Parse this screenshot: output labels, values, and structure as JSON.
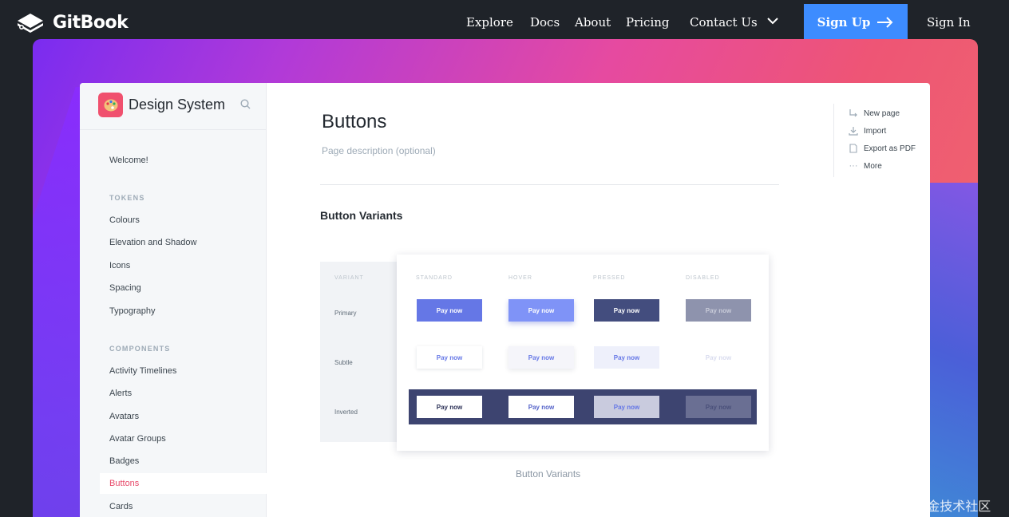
{
  "topnav": {
    "brand": "GitBook",
    "links": [
      "Explore",
      "Docs",
      "About",
      "Pricing",
      "Contact Us"
    ],
    "signup": "Sign Up",
    "signin": "Sign In"
  },
  "sidebar": {
    "space_title": "Design System",
    "welcome": "Welcome!",
    "tokens_heading": "TOKENS",
    "tokens": [
      "Colours",
      "Elevation and Shadow",
      "Icons",
      "Spacing",
      "Typography"
    ],
    "components_heading": "COMPONENTS",
    "components": [
      "Activity Timelines",
      "Alerts",
      "Avatars",
      "Avatar Groups",
      "Badges",
      "Buttons",
      "Cards"
    ],
    "active": "Buttons"
  },
  "page": {
    "title": "Buttons",
    "description": "Page description (optional)",
    "section_title": "Button Variants",
    "caption": "Button Variants"
  },
  "actions": [
    "New page",
    "Import",
    "Export as PDF",
    "More"
  ],
  "figure": {
    "variant_heading": "VARIANT",
    "states": [
      "STANDARD",
      "HOVER",
      "PRESSED",
      "DISABLED"
    ],
    "variants": [
      "Primary",
      "Subtle",
      "Inverted"
    ],
    "button_label": "Pay now"
  },
  "colors": {
    "signup_bg": "#3d8cff",
    "active_item": "#e84b6b",
    "primary": "#6577e6",
    "band": "#3d4470"
  },
  "watermark": "@稀土掘金技术社区"
}
